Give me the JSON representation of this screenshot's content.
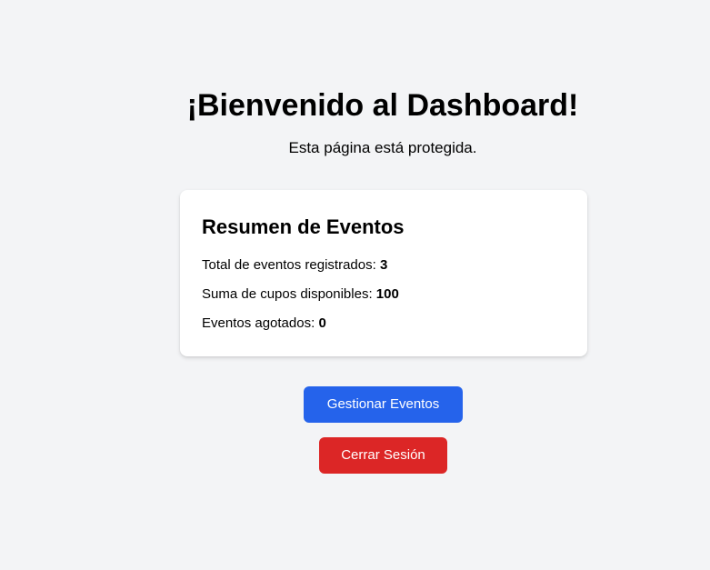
{
  "header": {
    "title": "¡Bienvenido al Dashboard!",
    "subtitle": "Esta página está protegida."
  },
  "summary": {
    "title": "Resumen de Eventos",
    "stats": [
      {
        "label": "Total de eventos registrados: ",
        "value": "3"
      },
      {
        "label": "Suma de cupos disponibles: ",
        "value": "100"
      },
      {
        "label": "Eventos agotados: ",
        "value": "0"
      }
    ]
  },
  "actions": {
    "manage_label": "Gestionar Eventos",
    "logout_label": "Cerrar Sesión"
  },
  "colors": {
    "background": "#f3f4f6",
    "primary": "#2563eb",
    "danger": "#dc2626"
  }
}
